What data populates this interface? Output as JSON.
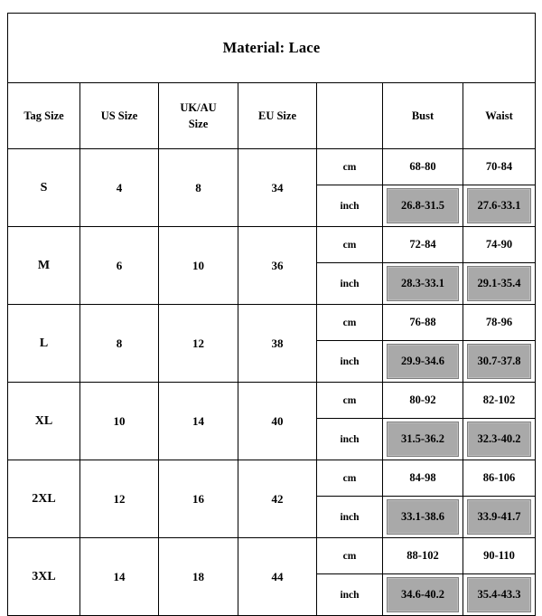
{
  "title": "Material: Lace",
  "headers": {
    "tag_size": "Tag Size",
    "us_size": "US Size",
    "uk_au_size_line1": "UK/AU",
    "uk_au_size_line2": "Size",
    "eu_size": "EU Size",
    "unit": "",
    "bust": "Bust",
    "waist": "Waist"
  },
  "units": {
    "cm": "cm",
    "inch": "inch"
  },
  "colors": {
    "shaded_cell": "#a9a9a9",
    "border": "#000000",
    "background": "#ffffff"
  },
  "rows": [
    {
      "tag_size": "S",
      "us_size": "4",
      "uk_au_size": "8",
      "eu_size": "34",
      "bust_cm": "68-80",
      "waist_cm": "70-84",
      "bust_inch": "26.8-31.5",
      "waist_inch": "27.6-33.1"
    },
    {
      "tag_size": "M",
      "us_size": "6",
      "uk_au_size": "10",
      "eu_size": "36",
      "bust_cm": "72-84",
      "waist_cm": "74-90",
      "bust_inch": "28.3-33.1",
      "waist_inch": "29.1-35.4"
    },
    {
      "tag_size": "L",
      "us_size": "8",
      "uk_au_size": "12",
      "eu_size": "38",
      "bust_cm": "76-88",
      "waist_cm": "78-96",
      "bust_inch": "29.9-34.6",
      "waist_inch": "30.7-37.8"
    },
    {
      "tag_size": "XL",
      "us_size": "10",
      "uk_au_size": "14",
      "eu_size": "40",
      "bust_cm": "80-92",
      "waist_cm": "82-102",
      "bust_inch": "31.5-36.2",
      "waist_inch": "32.3-40.2"
    },
    {
      "tag_size": "2XL",
      "us_size": "12",
      "uk_au_size": "16",
      "eu_size": "42",
      "bust_cm": "84-98",
      "waist_cm": "86-106",
      "bust_inch": "33.1-38.6",
      "waist_inch": "33.9-41.7"
    },
    {
      "tag_size": "3XL",
      "us_size": "14",
      "uk_au_size": "18",
      "eu_size": "44",
      "bust_cm": "88-102",
      "waist_cm": "90-110",
      "bust_inch": "34.6-40.2",
      "waist_inch": "35.4-43.3"
    }
  ],
  "chart_data": {
    "type": "table",
    "title": "Material: Lace",
    "columns": [
      "Tag Size",
      "US Size",
      "UK/AU Size",
      "EU Size",
      "",
      "Bust",
      "Waist"
    ],
    "unit_rows": [
      "cm",
      "inch"
    ],
    "rows": [
      {
        "tag_size": "S",
        "us_size": "4",
        "uk_au_size": "8",
        "eu_size": "34",
        "bust_cm": "68-80",
        "waist_cm": "70-84",
        "bust_inch": "26.8-31.5",
        "waist_inch": "27.6-33.1"
      },
      {
        "tag_size": "M",
        "us_size": "6",
        "uk_au_size": "10",
        "eu_size": "36",
        "bust_cm": "72-84",
        "waist_cm": "74-90",
        "bust_inch": "28.3-33.1",
        "waist_inch": "29.1-35.4"
      },
      {
        "tag_size": "L",
        "us_size": "8",
        "uk_au_size": "12",
        "eu_size": "38",
        "bust_cm": "76-88",
        "waist_cm": "78-96",
        "bust_inch": "29.9-34.6",
        "waist_inch": "30.7-37.8"
      },
      {
        "tag_size": "XL",
        "us_size": "10",
        "uk_au_size": "14",
        "eu_size": "40",
        "bust_cm": "80-92",
        "waist_cm": "82-102",
        "bust_inch": "31.5-36.2",
        "waist_inch": "32.3-40.2"
      },
      {
        "tag_size": "2XL",
        "us_size": "12",
        "uk_au_size": "16",
        "eu_size": "42",
        "bust_cm": "84-98",
        "waist_cm": "86-106",
        "bust_inch": "33.1-38.6",
        "waist_inch": "33.9-41.7"
      },
      {
        "tag_size": "3XL",
        "us_size": "14",
        "uk_au_size": "18",
        "eu_size": "44",
        "bust_cm": "88-102",
        "waist_cm": "90-110",
        "bust_inch": "34.6-40.2",
        "waist_inch": "35.4-43.3"
      }
    ]
  }
}
